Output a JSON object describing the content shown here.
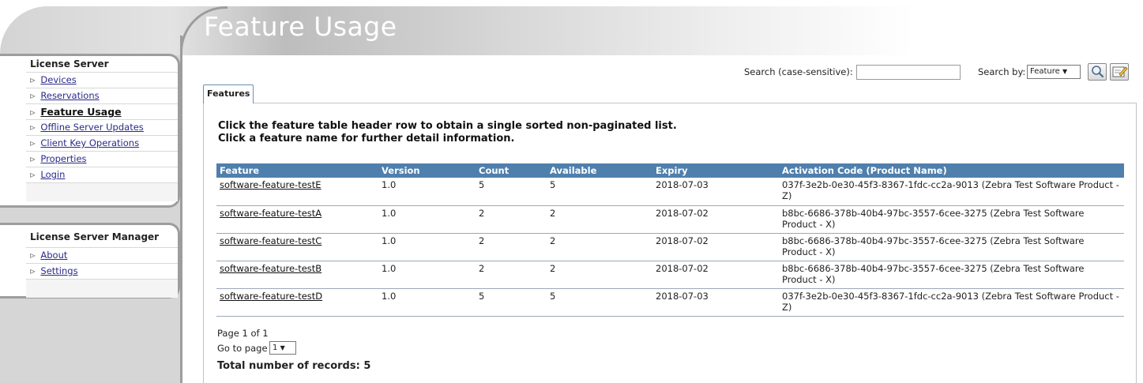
{
  "page": {
    "title": "Feature Usage"
  },
  "nav_license_server": {
    "title": "License Server",
    "items": [
      {
        "label": "Devices",
        "active": false
      },
      {
        "label": "Reservations",
        "active": false
      },
      {
        "label": "Feature Usage",
        "active": true
      },
      {
        "label": "Offline Server Updates",
        "active": false
      },
      {
        "label": "Client Key Operations",
        "active": false
      },
      {
        "label": "Properties",
        "active": false
      },
      {
        "label": "Login",
        "active": false
      }
    ]
  },
  "nav_manager": {
    "title": "License Server Manager",
    "items": [
      {
        "label": "About"
      },
      {
        "label": "Settings"
      }
    ]
  },
  "search": {
    "label": "Search (case-sensitive):",
    "value": "",
    "by_label": "Search by:",
    "by_value": "Feature",
    "search_icon": "magnifier-icon",
    "edit_icon": "edit-note-icon"
  },
  "tab": {
    "label": "Features"
  },
  "instructions": {
    "line1": "Click the feature table header row to obtain a single sorted non-paginated list.",
    "line2": "Click a feature name for further detail information."
  },
  "table": {
    "headers": [
      "Feature",
      "Version",
      "Count",
      "Available",
      "Expiry",
      "Activation Code (Product Name)"
    ],
    "rows": [
      [
        "software-feature-testE",
        "1.0",
        "5",
        "5",
        "2018-07-03",
        "037f-3e2b-0e30-45f3-8367-1fdc-cc2a-9013 (Zebra Test Software Product - Z)"
      ],
      [
        "software-feature-testA",
        "1.0",
        "2",
        "2",
        "2018-07-02",
        "b8bc-6686-378b-40b4-97bc-3557-6cee-3275 (Zebra Test Software Product - X)"
      ],
      [
        "software-feature-testC",
        "1.0",
        "2",
        "2",
        "2018-07-02",
        "b8bc-6686-378b-40b4-97bc-3557-6cee-3275 (Zebra Test Software Product - X)"
      ],
      [
        "software-feature-testB",
        "1.0",
        "2",
        "2",
        "2018-07-02",
        "b8bc-6686-378b-40b4-97bc-3557-6cee-3275 (Zebra Test Software Product - X)"
      ],
      [
        "software-feature-testD",
        "1.0",
        "5",
        "5",
        "2018-07-03",
        "037f-3e2b-0e30-45f3-8367-1fdc-cc2a-9013 (Zebra Test Software Product - Z)"
      ]
    ]
  },
  "pagination": {
    "page_info": "Page 1 of 1",
    "goto_label": "Go to page",
    "goto_value": "1"
  },
  "total": "Total number of records: 5",
  "colors": {
    "header_bg": "#4f7fad",
    "frame_gray": "#9d9d9d",
    "nav_link": "#2a2a8a"
  }
}
